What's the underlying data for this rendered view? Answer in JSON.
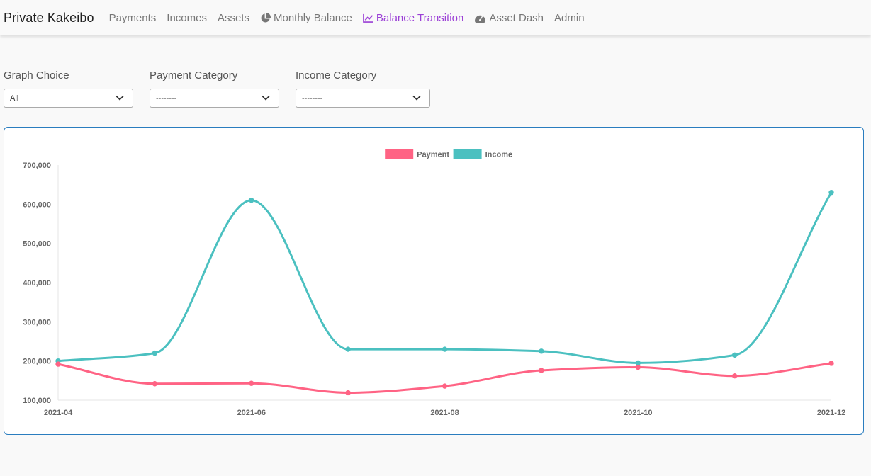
{
  "navbar": {
    "brand": "Private Kakeibo",
    "links": [
      {
        "label": "Payments",
        "icon": null
      },
      {
        "label": "Incomes",
        "icon": null
      },
      {
        "label": "Assets",
        "icon": null
      },
      {
        "label": "Monthly Balance",
        "icon": "pie-chart-icon"
      },
      {
        "label": "Balance Transition",
        "icon": "line-chart-icon",
        "active": true
      },
      {
        "label": "Asset Dash",
        "icon": "gauge-icon"
      },
      {
        "label": "Admin",
        "icon": null
      }
    ]
  },
  "filters": {
    "graph_choice": {
      "label": "Graph Choice",
      "value": "All"
    },
    "payment_category": {
      "label": "Payment Category",
      "value": "--------"
    },
    "income_category": {
      "label": "Income Category",
      "value": "--------"
    }
  },
  "colors": {
    "payment": "#ff6384",
    "income": "#4bc0c0",
    "active_link": "#9b3fd6",
    "card_border": "#2a7dbf"
  },
  "chart_data": {
    "type": "line",
    "x": [
      "2021-04",
      "2021-05",
      "2021-06",
      "2021-07",
      "2021-08",
      "2021-09",
      "2021-10",
      "2021-11",
      "2021-12"
    ],
    "x_tick_labels": [
      "2021-04",
      "2021-06",
      "2021-08",
      "2021-10",
      "2021-12"
    ],
    "y_tick_labels": [
      "100,000",
      "200,000",
      "300,000",
      "400,000",
      "500,000",
      "600,000",
      "700,000"
    ],
    "ylim": [
      100000,
      700000
    ],
    "legend_position": "top",
    "grid": false,
    "series": [
      {
        "name": "Payment",
        "color": "#ff6384",
        "values": [
          192000,
          142000,
          143000,
          119000,
          136000,
          176000,
          184000,
          162000,
          194000
        ]
      },
      {
        "name": "Income",
        "color": "#4bc0c0",
        "values": [
          200000,
          220000,
          610000,
          230000,
          230000,
          225000,
          195000,
          215000,
          630000
        ]
      }
    ]
  }
}
